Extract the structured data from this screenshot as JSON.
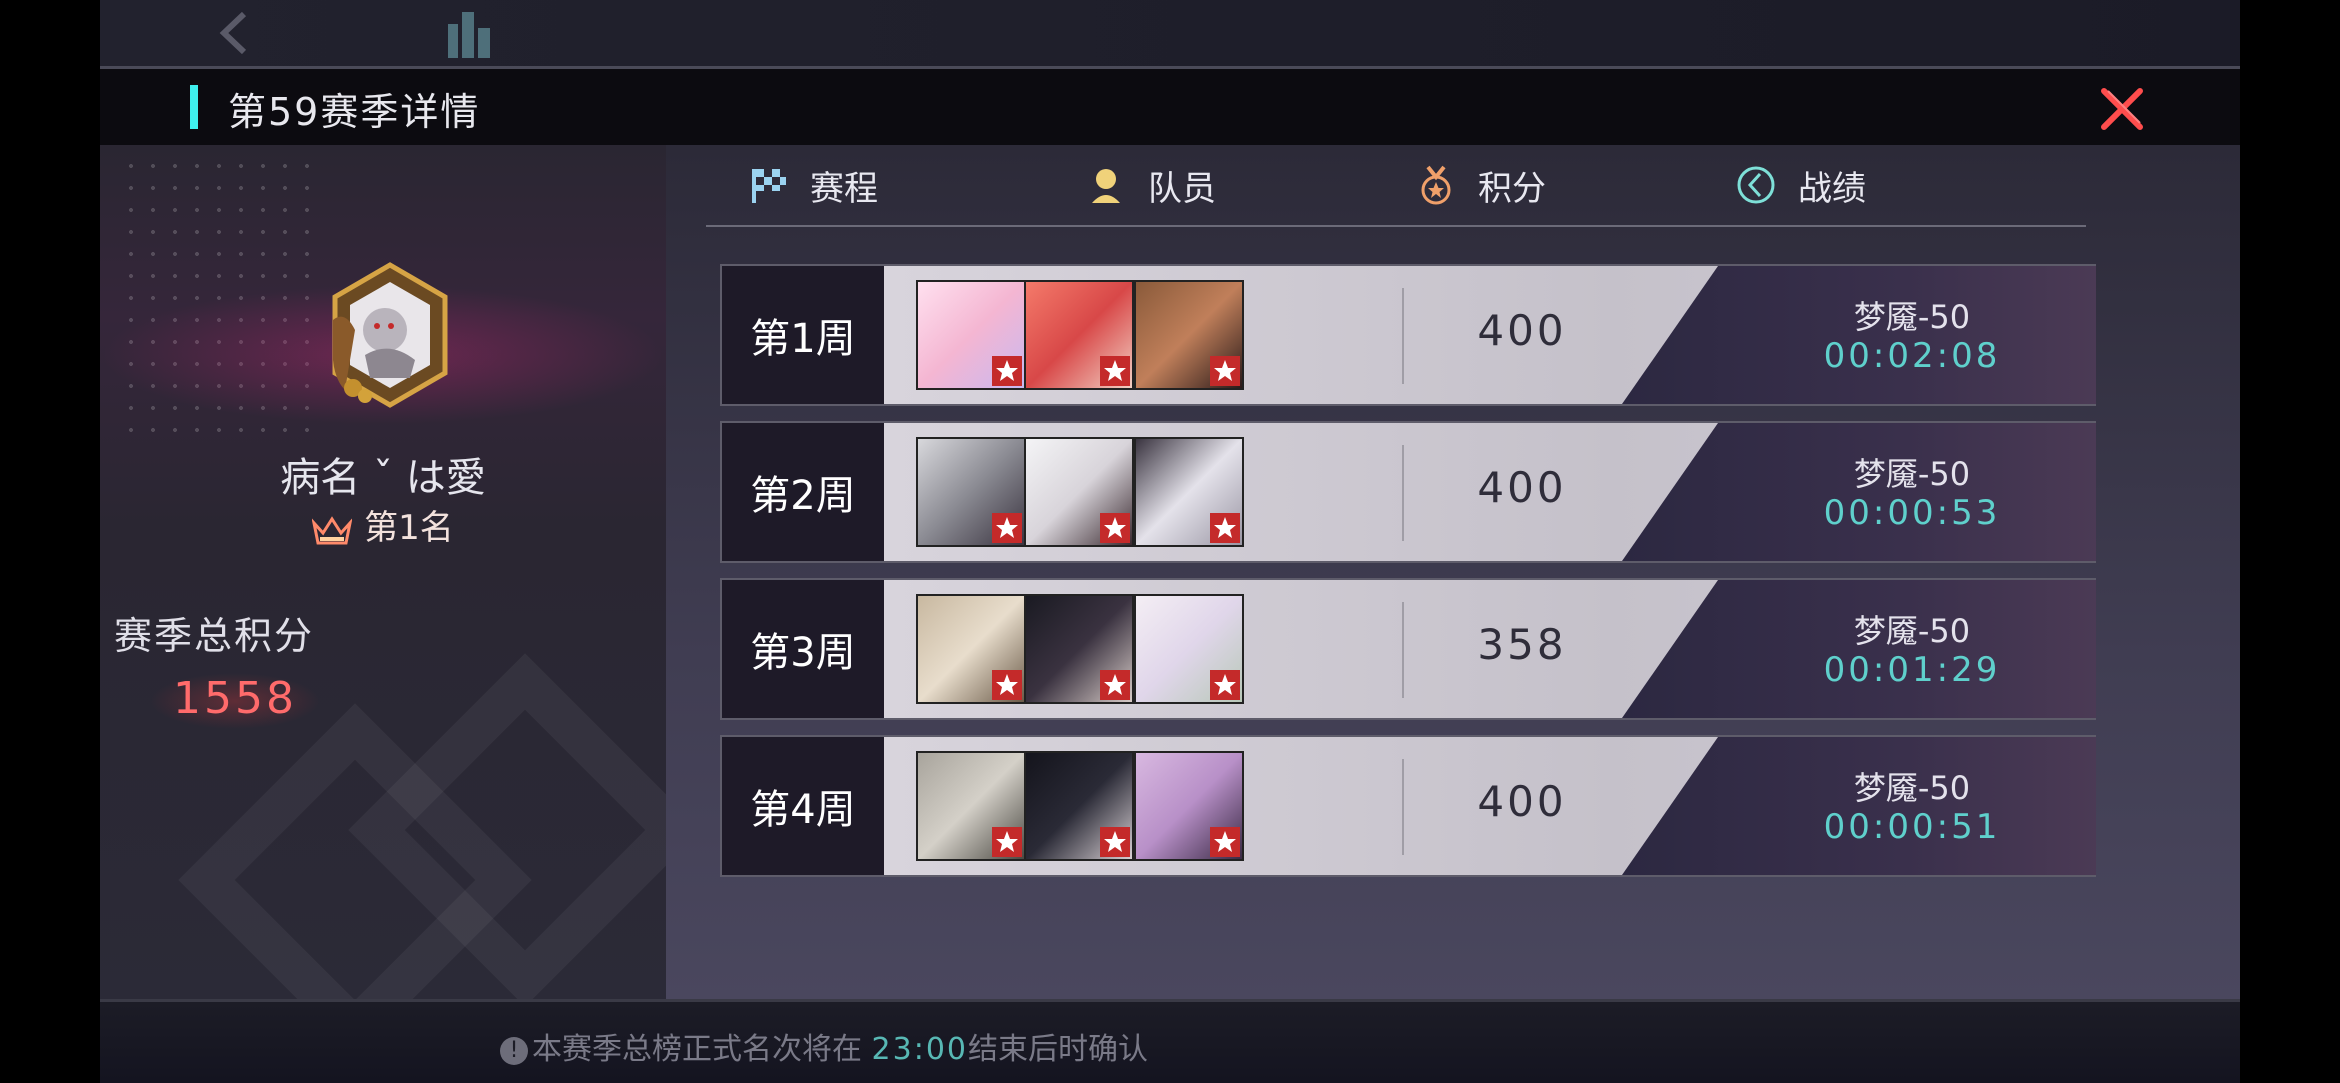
{
  "header": {
    "title": "第59赛季详情"
  },
  "player": {
    "name": "病名 ˇ は愛",
    "rank": "第1名",
    "total_label": "赛季总积分",
    "total_score": "1558"
  },
  "tabs": [
    {
      "label": "赛程",
      "icon": "checkered-flag-icon",
      "active": true
    },
    {
      "label": "队员",
      "icon": "member-icon",
      "active": false
    },
    {
      "label": "积分",
      "icon": "medal-icon",
      "active": false
    },
    {
      "label": "战绩",
      "icon": "clock-record-icon",
      "active": false
    }
  ],
  "weeks": [
    {
      "label": "第1周",
      "score": "400",
      "level": "梦魇-50",
      "time": "00:02:08"
    },
    {
      "label": "第2周",
      "score": "400",
      "level": "梦魇-50",
      "time": "00:00:53"
    },
    {
      "label": "第3周",
      "score": "358",
      "level": "梦魇-50",
      "time": "00:01:29"
    },
    {
      "label": "第4周",
      "score": "400",
      "level": "梦魇-50",
      "time": "00:00:51"
    }
  ],
  "footer": {
    "notice_prefix": "本赛季总榜正式名次将在",
    "notice_time": "23:00",
    "notice_suffix": "结束后时确认"
  },
  "colors": {
    "accent_cyan": "#3ff0ee",
    "close_red": "#ff4d4d",
    "score_red": "#ff6b6b",
    "time_teal": "#5fd0cc"
  }
}
